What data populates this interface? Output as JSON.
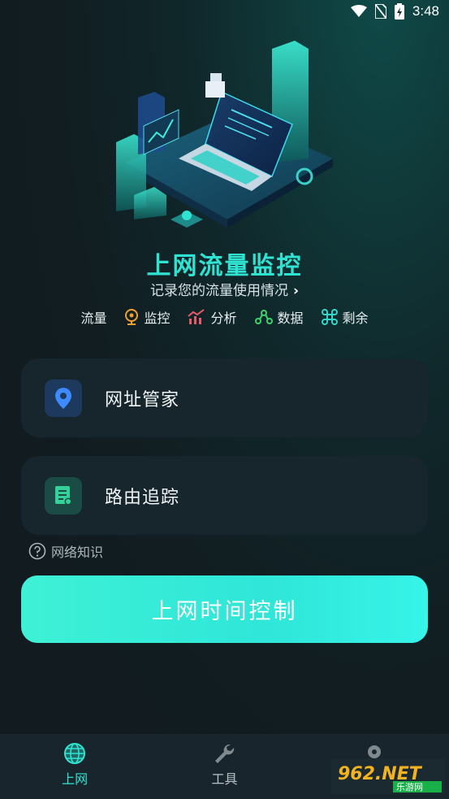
{
  "status_bar": {
    "time": "3:48"
  },
  "hero": {
    "title": "上网流量监控",
    "subtitle": "记录您的流量使用情况"
  },
  "features": [
    {
      "label": "流量",
      "icon": "none"
    },
    {
      "label": "监控",
      "icon": "webcam-icon",
      "color": "#f0a030"
    },
    {
      "label": "分析",
      "icon": "chart-up-icon",
      "color": "#e85a6a"
    },
    {
      "label": "数据",
      "icon": "nodes-icon",
      "color": "#3fd06a"
    },
    {
      "label": "剩余",
      "icon": "command-icon",
      "color": "#33d6c8"
    }
  ],
  "cards": {
    "url_manager": {
      "label": "网址管家",
      "icon": "location-pin-icon",
      "icon_color": "#3d8bff"
    },
    "route_trace": {
      "label": "路由追踪",
      "icon": "document-icon",
      "icon_color": "#34d29a"
    }
  },
  "help": {
    "label": "网络知识"
  },
  "cta": {
    "label": "上网时间控制",
    "color": "#34eedc"
  },
  "bottom_nav": {
    "items": [
      {
        "label": "上网",
        "icon": "globe-icon",
        "active": true
      },
      {
        "label": "工具",
        "icon": "wrench-icon",
        "active": false
      }
    ],
    "active_color": "#2fe3d2",
    "inactive_color": "#b8c2c6"
  },
  "watermark": {
    "text": "962.NET",
    "sub": "乐游网"
  }
}
